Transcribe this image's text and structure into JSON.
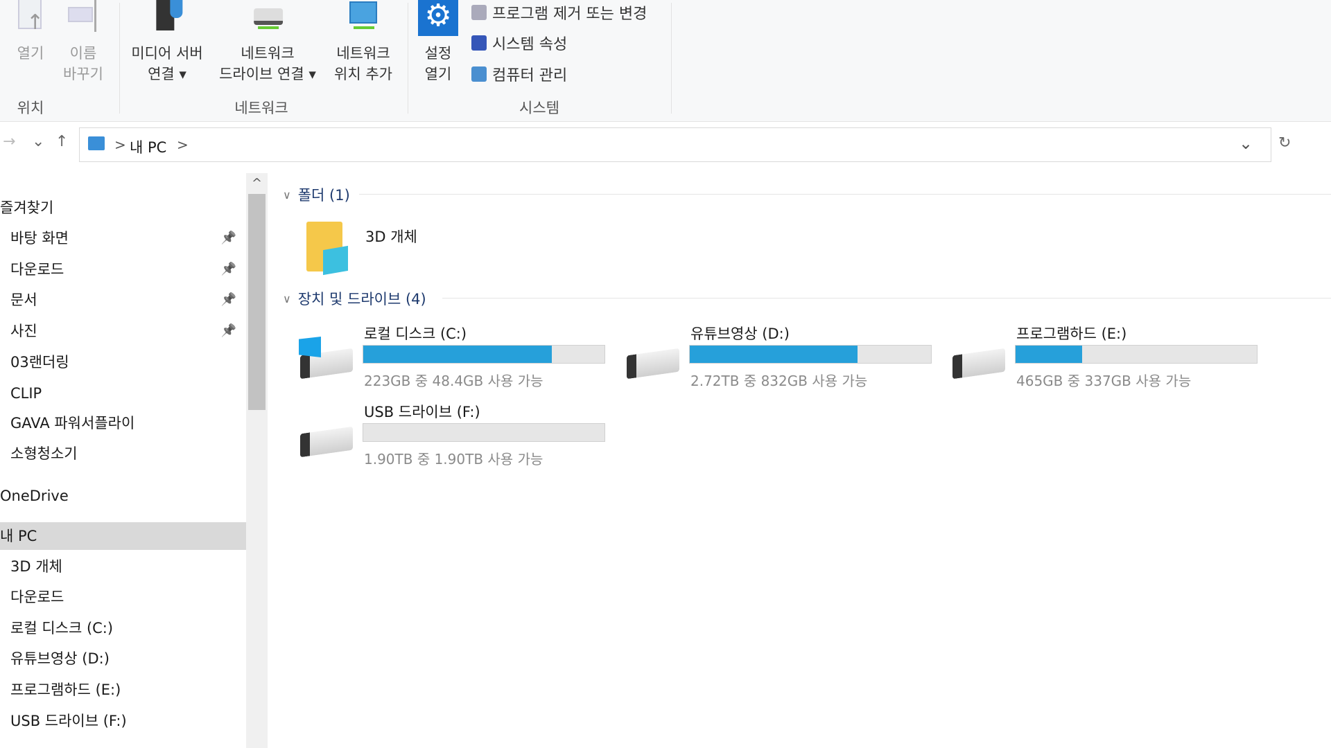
{
  "ribbon": {
    "buttons": [
      {
        "label1": "열기",
        "label2": "",
        "disabled": true,
        "icon": "open-file-icon"
      },
      {
        "label1": "이름",
        "label2": "바꾸기",
        "disabled": true,
        "icon": "rename-icon"
      },
      {
        "label1": "미디어 서버",
        "label2": "연결 ▾",
        "icon": "media-server-icon"
      },
      {
        "label1": "네트워크",
        "label2": "드라이브 연결 ▾",
        "icon": "network-drive-icon"
      },
      {
        "label1": "네트워크",
        "label2": "위치 추가",
        "icon": "network-location-icon"
      },
      {
        "label1": "설정",
        "label2": "열기",
        "icon": "settings-gear-icon"
      }
    ],
    "small": [
      {
        "label": "프로그램 제거 또는 변경",
        "icon": "uninstall-icon"
      },
      {
        "label": "시스템 속성",
        "icon": "system-properties-icon"
      },
      {
        "label": "컴퓨터 관리",
        "icon": "computer-management-icon"
      }
    ],
    "groups": [
      "위치",
      "네트워크",
      "시스템"
    ]
  },
  "address": {
    "back": "→",
    "dropdown": "⌄",
    "up": "↑",
    "crumbs": [
      "내 PC"
    ],
    "sep": ">",
    "refresh": "↻",
    "expand": "⌄"
  },
  "nav": {
    "scroll_up": "^",
    "items": [
      {
        "label": "즐겨찾기",
        "header": true
      },
      {
        "label": "바탕 화면",
        "pinned": true
      },
      {
        "label": "다운로드",
        "pinned": true
      },
      {
        "label": "문서",
        "pinned": true
      },
      {
        "label": "사진",
        "pinned": true
      },
      {
        "label": "03랜더링"
      },
      {
        "label": "CLIP"
      },
      {
        "label": "GAVA 파워서플라이"
      },
      {
        "label": "소형청소기"
      },
      {
        "label": "OneDrive",
        "header": true
      },
      {
        "label": "내 PC",
        "header": true,
        "selected": true
      },
      {
        "label": "3D 개체"
      },
      {
        "label": "다운로드"
      },
      {
        "label": "로컬 디스크 (C:)"
      },
      {
        "label": "유튜브영상 (D:)"
      },
      {
        "label": "프로그램하드 (E:)"
      },
      {
        "label": "USB 드라이브 (F:)"
      }
    ]
  },
  "content": {
    "folders_header": "폴더 (1)",
    "folders": [
      {
        "name": "3D 개체"
      }
    ],
    "drives_header": "장치 및 드라이브 (4)",
    "drives": [
      {
        "name": "로컬 디스크 (C:)",
        "info": "223GB 중 48.4GB 사용 가능",
        "used_percent": 78.3,
        "system": true
      },
      {
        "name": "유튜브영상 (D:)",
        "info": "2.72TB 중 832GB 사용 가능",
        "used_percent": 69.4
      },
      {
        "name": "프로그램하드 (E:)",
        "info": "465GB 중 337GB 사용 가능",
        "used_percent": 27.5
      },
      {
        "name": "USB 드라이브 (F:)",
        "info": "1.90TB 중 1.90TB 사용 가능",
        "used_percent": 0
      }
    ]
  },
  "colors": {
    "accent": "#26a0da",
    "selected": "#d9d9d9"
  }
}
